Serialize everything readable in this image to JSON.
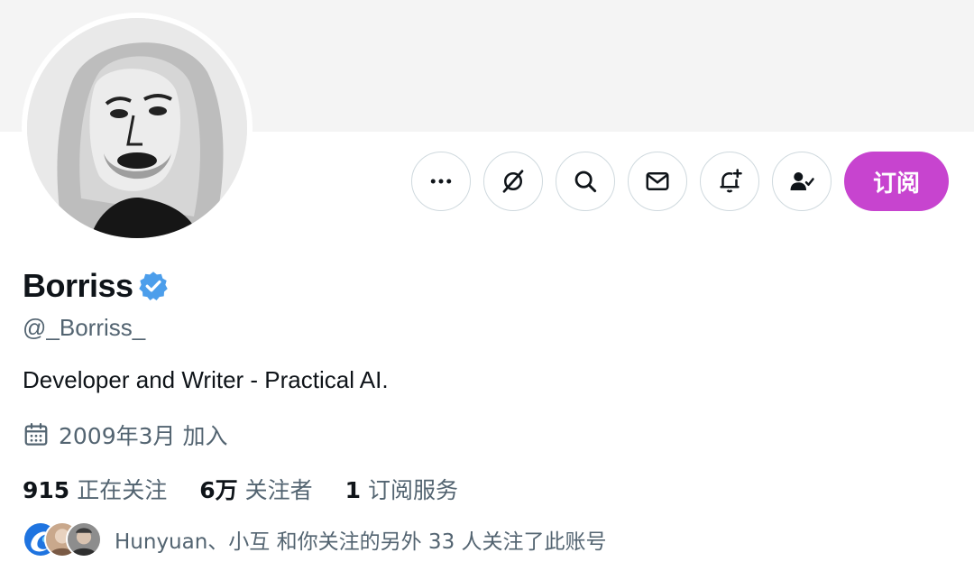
{
  "profile": {
    "display_name": "Borriss",
    "handle": "@_Borriss_",
    "bio": "Developer and Writer - Practical AI.",
    "joined": "2009年3月 加入",
    "verified_icon": "verified-badge-icon",
    "verified_color": "#4c9eeb"
  },
  "stats": {
    "following_count": "915",
    "following_label": "正在关注",
    "followers_count": "6万",
    "followers_label": "关注者",
    "subscriptions_count": "1",
    "subscriptions_label": "订阅服务"
  },
  "actions": {
    "more_icon": "more-icon",
    "grok_icon": "grok-icon",
    "search_icon": "search-icon",
    "message_icon": "mail-icon",
    "notify_icon": "bell-plus-icon",
    "following_icon": "person-check-icon",
    "subscribe_label": "订阅",
    "subscribe_color": "#c744cf"
  },
  "followed_by": {
    "text": "Hunyuan、小互 和你关注的另外 33 人关注了此账号"
  },
  "colors": {
    "banner": "#f4f4f4",
    "secondary_text": "#536471",
    "primary_text": "#0f1419",
    "button_border": "#cfd9de"
  }
}
